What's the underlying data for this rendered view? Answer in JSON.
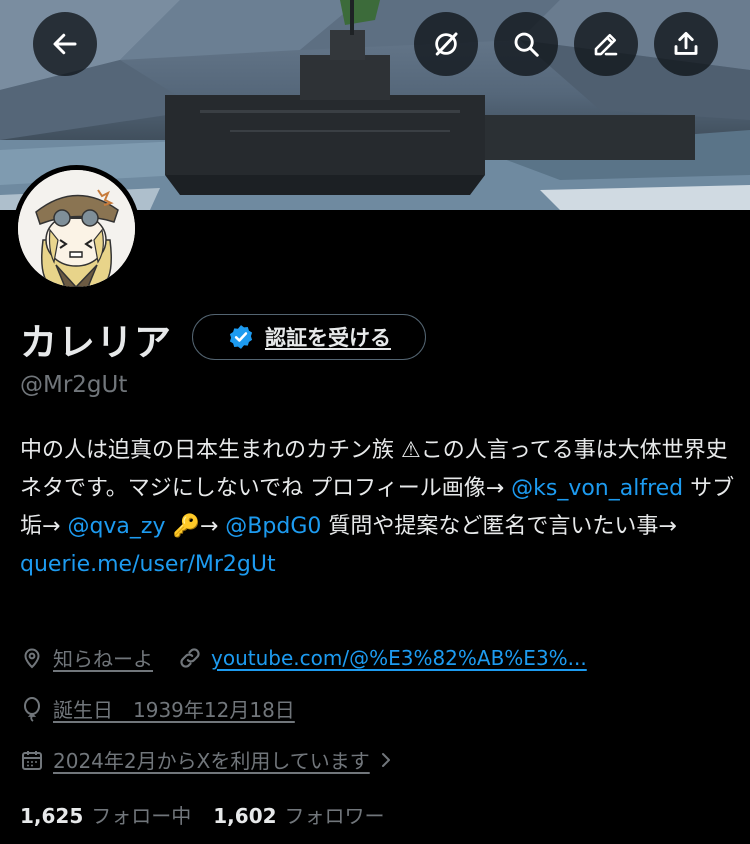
{
  "profile": {
    "display_name": "カレリア",
    "handle": "@Mr2gUt",
    "verify_label": "認証を受ける",
    "bio": [
      {
        "type": "text",
        "text": "中の人は迫真の日本生まれのカチン族 ⚠この人言ってる事は大体世界史ネタです。マジにしないでね プロフィール画像→ "
      },
      {
        "type": "link",
        "text": "@ks_von_alfred"
      },
      {
        "type": "text",
        "text": " サブ垢→ "
      },
      {
        "type": "link",
        "text": "@qva_zy"
      },
      {
        "type": "text",
        "text": " 🔑→ "
      },
      {
        "type": "link",
        "text": "@BpdG0"
      },
      {
        "type": "text",
        "text": " 質問や提案など匿名で言いたい事→ "
      },
      {
        "type": "link",
        "text": "querie.me/user/Mr2gUt"
      }
    ],
    "location": "知らねーよ",
    "website": "youtube.com/@%E3%82%AB%E3%...",
    "birthday": "誕生日　1939年12月18日",
    "joined": "2024年2月からXを利用しています",
    "following_count": "1,625",
    "following_label": "フォロー中",
    "followers_count": "1,602",
    "followers_label": "フォロワー"
  },
  "header_buttons": [
    "back-icon",
    "grok-icon",
    "search-icon",
    "edit-icon",
    "share-icon"
  ],
  "colors": {
    "link": "#1d9bf0",
    "verified": "#1d9bf0",
    "muted": "#71767b",
    "text": "#e7e9ea",
    "background": "#000000"
  }
}
